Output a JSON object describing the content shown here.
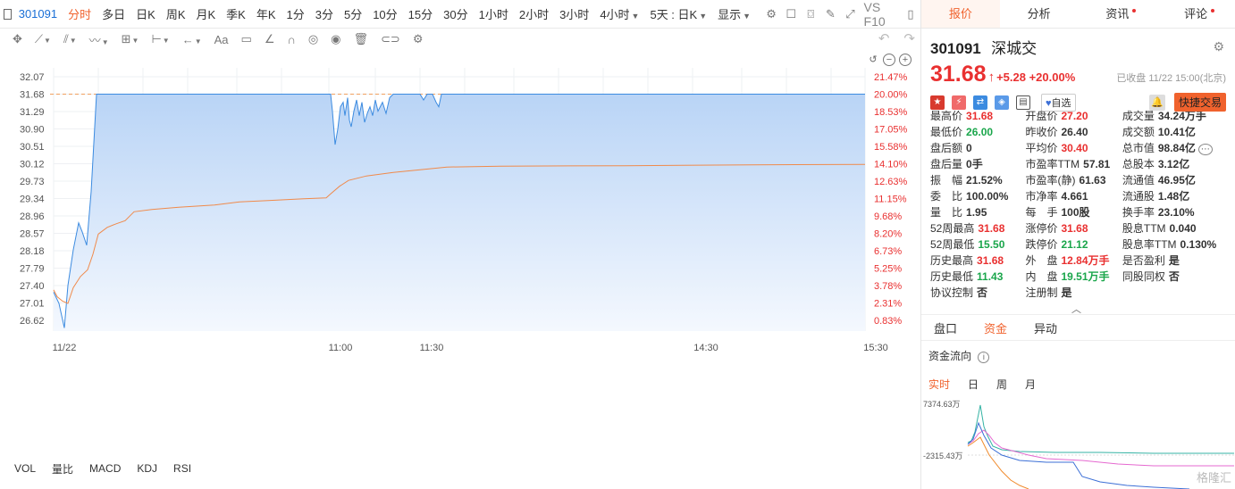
{
  "period_bar": {
    "code": "301091",
    "periods": [
      "分时",
      "多日",
      "日K",
      "周K",
      "月K",
      "季K",
      "年K",
      "1分",
      "3分",
      "5分",
      "10分",
      "15分",
      "30分",
      "1小时",
      "2小时",
      "3小时",
      "4小时",
      "5天 : 日K",
      "显示"
    ],
    "active_period": "分时",
    "vs_label": "VS F10"
  },
  "tool_bar": {
    "font_tool": "Aa"
  },
  "chart": {
    "left_axis": [
      "32.07",
      "31.68",
      "31.29",
      "30.90",
      "30.51",
      "30.12",
      "29.73",
      "29.34",
      "28.96",
      "28.57",
      "28.18",
      "27.79",
      "27.40",
      "27.01",
      "26.62"
    ],
    "right_axis": [
      "21.47%",
      "20.00%",
      "18.53%",
      "17.05%",
      "15.58%",
      "14.10%",
      "12.63%",
      "11.15%",
      "9.68%",
      "8.20%",
      "6.73%",
      "5.25%",
      "3.78%",
      "2.31%",
      "0.83%"
    ],
    "x_labels": [
      "11/22",
      "11:00",
      "11:30",
      "14:30",
      "15:30"
    ],
    "limit_up_price": "31.68",
    "limit_up_pct": "20.00%"
  },
  "indicators": [
    "VOL",
    "量比",
    "MACD",
    "KDJ",
    "RSI"
  ],
  "panel": {
    "tabs": [
      "报价",
      "分析",
      "资讯",
      "评论"
    ],
    "active_tab": "报价",
    "code": "301091",
    "name": "深城交",
    "price": "31.68",
    "arrow": "↑",
    "change": "+5.28 +20.00%",
    "closed_text": "已收盘 11/22 15:00(北京)",
    "fav_label": "自选",
    "fast_trade": "快捷交易",
    "quotes": [
      [
        {
          "k": "最高价",
          "v": "31.68",
          "c": "red"
        },
        {
          "k": "开盘价",
          "v": "27.20",
          "c": "red"
        },
        {
          "k": "成交量",
          "v": "34.24万手",
          "c": ""
        }
      ],
      [
        {
          "k": "最低价",
          "v": "26.00",
          "c": "green"
        },
        {
          "k": "昨收价",
          "v": "26.40",
          "c": ""
        },
        {
          "k": "成交额",
          "v": "10.41亿",
          "c": ""
        }
      ],
      [
        {
          "k": "盘后额",
          "v": "0",
          "c": ""
        },
        {
          "k": "平均价",
          "v": "30.40",
          "c": "red"
        },
        {
          "k": "总市值",
          "v": "98.84亿",
          "c": ""
        }
      ],
      [
        {
          "k": "盘后量",
          "v": "0手",
          "c": ""
        },
        {
          "k": "市盈率TTM",
          "v": "57.81",
          "c": ""
        },
        {
          "k": "总股本",
          "v": "3.12亿",
          "c": ""
        }
      ],
      [
        {
          "k": "振　幅",
          "v": "21.52%",
          "c": ""
        },
        {
          "k": "市盈率(静)",
          "v": "61.63",
          "c": ""
        },
        {
          "k": "流通值",
          "v": "46.95亿",
          "c": ""
        }
      ],
      [
        {
          "k": "委　比",
          "v": "100.00%",
          "c": ""
        },
        {
          "k": "市净率",
          "v": "4.661",
          "c": ""
        },
        {
          "k": "流通股",
          "v": "1.48亿",
          "c": ""
        }
      ],
      [
        {
          "k": "量　比",
          "v": "1.95",
          "c": ""
        },
        {
          "k": "每　手",
          "v": "100股",
          "c": ""
        },
        {
          "k": "换手率",
          "v": "23.10%",
          "c": ""
        }
      ],
      [
        {
          "k": "52周最高",
          "v": "31.68",
          "c": "red"
        },
        {
          "k": "涨停价",
          "v": "31.68",
          "c": "red"
        },
        {
          "k": "股息TTM",
          "v": "0.040",
          "c": ""
        }
      ],
      [
        {
          "k": "52周最低",
          "v": "15.50",
          "c": "green"
        },
        {
          "k": "跌停价",
          "v": "21.12",
          "c": "green"
        },
        {
          "k": "股息率TTM",
          "v": "0.130%",
          "c": ""
        }
      ],
      [
        {
          "k": "历史最高",
          "v": "31.68",
          "c": "red"
        },
        {
          "k": "外　盘",
          "v": "12.84万手",
          "c": "red"
        },
        {
          "k": "是否盈利",
          "v": "是",
          "c": ""
        }
      ],
      [
        {
          "k": "历史最低",
          "v": "11.43",
          "c": "green"
        },
        {
          "k": "内　盘",
          "v": "19.51万手",
          "c": "green"
        },
        {
          "k": "同股同权",
          "v": "否",
          "c": ""
        }
      ],
      [
        {
          "k": "协议控制",
          "v": "否",
          "c": ""
        },
        {
          "k": "注册制",
          "v": "是",
          "c": ""
        },
        {
          "k": "",
          "v": "",
          "c": ""
        }
      ]
    ],
    "sub_tabs": [
      "盘口",
      "资金",
      "异动"
    ],
    "active_sub_tab": "资金",
    "flow_title": "资金流向",
    "flow_tabs": [
      "实时",
      "日",
      "周",
      "月"
    ],
    "active_flow_tab": "实时",
    "flow_top": "7374.63万",
    "flow_bottom": "-2315.43万",
    "watermark": "格隆汇"
  },
  "colors": {
    "up": "#e93030",
    "down": "#1aa64b",
    "accent": "#f0622d",
    "line": "#3c8be0",
    "avg": "#f08a4b"
  }
}
